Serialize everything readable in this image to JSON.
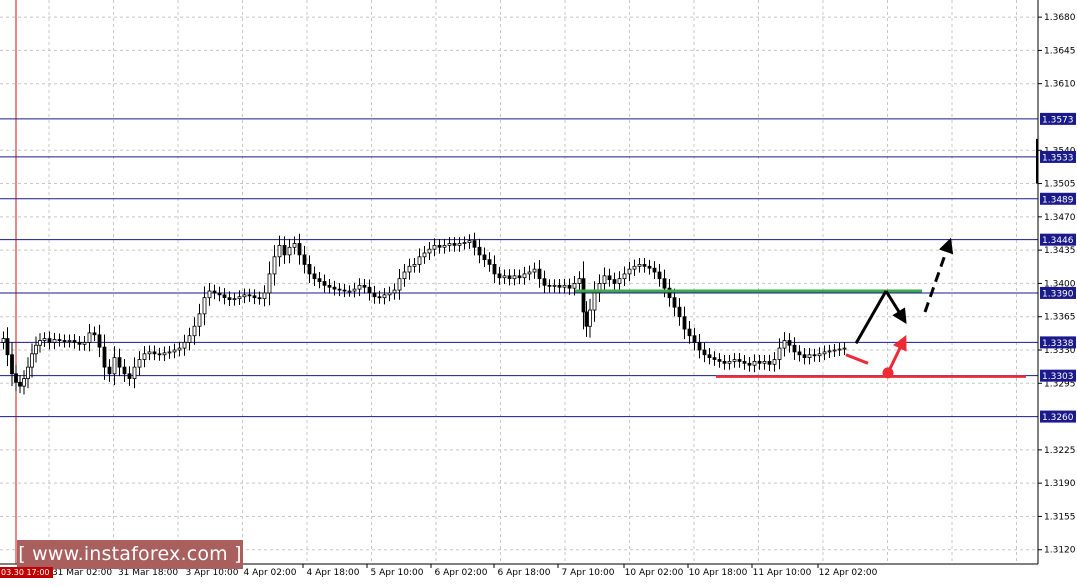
{
  "watermark": "[ www.instaforex.com ]",
  "cursor_label": "03.30 17:00",
  "chart_data": {
    "type": "candlestick",
    "ylim": [
      1.3105,
      1.3698
    ],
    "y_ticks": [
      "1.3680",
      "1.3645",
      "1.3610",
      "1.3540",
      "1.3505",
      "1.3470",
      "1.3435",
      "1.3400",
      "1.3365",
      "1.3330",
      "1.3295",
      "1.3225",
      "1.3190",
      "1.3155",
      "1.3120"
    ],
    "x_tick_labels": [
      "31 Mar 02:00",
      "31 Mar 18:00",
      "3 Apr 10:00",
      "4 Apr 02:00",
      "4 Apr 18:00",
      "5 Apr 10:00",
      "6 Apr 02:00",
      "6 Apr 18:00",
      "7 Apr 10:00",
      "10 Apr 02:00",
      "10 Apr 18:00",
      "11 Apr 10:00",
      "12 Apr 02:00"
    ],
    "levels": [
      {
        "label": "1.3573",
        "value": 1.3573
      },
      {
        "label": "1.3533",
        "value": 1.3533
      },
      {
        "label": "1.3489",
        "value": 1.3489
      },
      {
        "label": "1.3446",
        "value": 1.3446
      },
      {
        "label": "1.3390",
        "value": 1.339
      },
      {
        "label": "1.3338",
        "value": 1.3338
      },
      {
        "label": "1.3303",
        "value": 1.3303
      },
      {
        "label": "1.3260",
        "value": 1.326
      }
    ],
    "support_line": {
      "value": 1.3302,
      "color": "#ee2a35"
    },
    "resistance_line": {
      "value": 1.3392,
      "color": "#3aaa4a"
    },
    "price_path": [
      [
        0,
        1.3338
      ],
      [
        3,
        1.3342
      ],
      [
        8,
        1.3325
      ],
      [
        12,
        1.3305
      ],
      [
        16,
        1.3296
      ],
      [
        20,
        1.3292
      ],
      [
        24,
        1.33
      ],
      [
        28,
        1.3312
      ],
      [
        32,
        1.3326
      ],
      [
        36,
        1.3335
      ],
      [
        40,
        1.334
      ],
      [
        45,
        1.3342
      ],
      [
        50,
        1.3338
      ],
      [
        55,
        1.3341
      ],
      [
        60,
        1.334
      ],
      [
        65,
        1.3339
      ],
      [
        70,
        1.334
      ],
      [
        75,
        1.3338
      ],
      [
        80,
        1.3336
      ],
      [
        85,
        1.3338
      ],
      [
        90,
        1.3348
      ],
      [
        95,
        1.3346
      ],
      [
        100,
        1.3333
      ],
      [
        105,
        1.3312
      ],
      [
        110,
        1.3305
      ],
      [
        115,
        1.3322
      ],
      [
        120,
        1.3312
      ],
      [
        125,
        1.3305
      ],
      [
        130,
        1.33
      ],
      [
        135,
        1.3312
      ],
      [
        140,
        1.332
      ],
      [
        145,
        1.3326
      ],
      [
        150,
        1.3328
      ],
      [
        155,
        1.3326
      ],
      [
        160,
        1.3325
      ],
      [
        165,
        1.3327
      ],
      [
        170,
        1.3328
      ],
      [
        175,
        1.333
      ],
      [
        180,
        1.3332
      ],
      [
        185,
        1.3338
      ],
      [
        190,
        1.3345
      ],
      [
        195,
        1.3355
      ],
      [
        200,
        1.3368
      ],
      [
        205,
        1.3385
      ],
      [
        210,
        1.3392
      ],
      [
        215,
        1.339
      ],
      [
        220,
        1.3388
      ],
      [
        225,
        1.3385
      ],
      [
        230,
        1.3383
      ],
      [
        235,
        1.3384
      ],
      [
        240,
        1.3386
      ],
      [
        245,
        1.3388
      ],
      [
        250,
        1.3387
      ],
      [
        255,
        1.3385
      ],
      [
        260,
        1.3384
      ],
      [
        265,
        1.339
      ],
      [
        270,
        1.341
      ],
      [
        275,
        1.3428
      ],
      [
        280,
        1.344
      ],
      [
        285,
        1.343
      ],
      [
        290,
        1.3438
      ],
      [
        295,
        1.3442
      ],
      [
        300,
        1.343
      ],
      [
        305,
        1.342
      ],
      [
        310,
        1.341
      ],
      [
        315,
        1.3405
      ],
      [
        320,
        1.3402
      ],
      [
        325,
        1.3398
      ],
      [
        330,
        1.3396
      ],
      [
        335,
        1.3394
      ],
      [
        340,
        1.3393
      ],
      [
        345,
        1.3392
      ],
      [
        350,
        1.3392
      ],
      [
        355,
        1.3394
      ],
      [
        360,
        1.3398
      ],
      [
        365,
        1.3396
      ],
      [
        370,
        1.339
      ],
      [
        375,
        1.3386
      ],
      [
        380,
        1.3385
      ],
      [
        385,
        1.3388
      ],
      [
        390,
        1.339
      ],
      [
        395,
        1.3393
      ],
      [
        400,
        1.3405
      ],
      [
        405,
        1.3412
      ],
      [
        410,
        1.3418
      ],
      [
        415,
        1.342
      ],
      [
        420,
        1.3428
      ],
      [
        425,
        1.3432
      ],
      [
        430,
        1.3436
      ],
      [
        435,
        1.344
      ],
      [
        440,
        1.3438
      ],
      [
        445,
        1.344
      ],
      [
        450,
        1.3442
      ],
      [
        455,
        1.344
      ],
      [
        460,
        1.3442
      ],
      [
        465,
        1.3443
      ],
      [
        470,
        1.3445
      ],
      [
        475,
        1.3438
      ],
      [
        480,
        1.343
      ],
      [
        485,
        1.3425
      ],
      [
        490,
        1.342
      ],
      [
        495,
        1.341
      ],
      [
        500,
        1.3406
      ],
      [
        505,
        1.3408
      ],
      [
        510,
        1.3405
      ],
      [
        515,
        1.3408
      ],
      [
        520,
        1.3406
      ],
      [
        525,
        1.341
      ],
      [
        530,
        1.3412
      ],
      [
        535,
        1.3415
      ],
      [
        540,
        1.3405
      ],
      [
        545,
        1.3398
      ],
      [
        550,
        1.3397
      ],
      [
        555,
        1.3398
      ],
      [
        560,
        1.3396
      ],
      [
        565,
        1.3398
      ],
      [
        570,
        1.3395
      ],
      [
        575,
        1.34
      ],
      [
        580,
        1.3405
      ],
      [
        583,
        1.337
      ],
      [
        586,
        1.3355
      ],
      [
        590,
        1.3372
      ],
      [
        595,
        1.339
      ],
      [
        600,
        1.34
      ],
      [
        605,
        1.3408
      ],
      [
        610,
        1.3404
      ],
      [
        615,
        1.34
      ],
      [
        620,
        1.3405
      ],
      [
        625,
        1.341
      ],
      [
        630,
        1.3415
      ],
      [
        635,
        1.3418
      ],
      [
        640,
        1.342
      ],
      [
        645,
        1.3418
      ],
      [
        650,
        1.3416
      ],
      [
        655,
        1.3412
      ],
      [
        660,
        1.3405
      ],
      [
        665,
        1.3395
      ],
      [
        670,
        1.3385
      ],
      [
        675,
        1.3375
      ],
      [
        680,
        1.3365
      ],
      [
        685,
        1.3352
      ],
      [
        690,
        1.3345
      ],
      [
        695,
        1.3338
      ],
      [
        700,
        1.333
      ],
      [
        705,
        1.3325
      ],
      [
        710,
        1.3322
      ],
      [
        715,
        1.332
      ],
      [
        720,
        1.3318
      ],
      [
        725,
        1.3316
      ],
      [
        730,
        1.3318
      ],
      [
        735,
        1.332
      ],
      [
        740,
        1.3318
      ],
      [
        745,
        1.3316
      ],
      [
        750,
        1.3314
      ],
      [
        755,
        1.3318
      ],
      [
        760,
        1.3316
      ],
      [
        765,
        1.3318
      ],
      [
        770,
        1.3315
      ],
      [
        775,
        1.332
      ],
      [
        780,
        1.3332
      ],
      [
        785,
        1.334
      ],
      [
        790,
        1.3335
      ],
      [
        795,
        1.3328
      ],
      [
        800,
        1.3325
      ],
      [
        805,
        1.3322
      ],
      [
        810,
        1.3325
      ],
      [
        815,
        1.3324
      ],
      [
        820,
        1.3326
      ],
      [
        825,
        1.3328
      ],
      [
        830,
        1.3329
      ],
      [
        835,
        1.333
      ],
      [
        840,
        1.3331
      ],
      [
        845,
        1.3332
      ]
    ],
    "forecast_arrows": [
      {
        "style": "solid",
        "color": "#000000",
        "from": [
          856,
          1.3337
        ],
        "to": [
          886,
          1.3392
        ]
      },
      {
        "style": "solid",
        "color": "#000000",
        "from": [
          886,
          1.3392
        ],
        "to": [
          905,
          1.336
        ]
      },
      {
        "style": "dashed",
        "color": "#000000",
        "from": [
          925,
          1.337
        ],
        "to": [
          950,
          1.3445
        ]
      },
      {
        "style": "solid",
        "color": "#ee2a35",
        "from": [
          888,
          1.3306
        ],
        "to": [
          905,
          1.3343
        ]
      },
      {
        "style": "solid",
        "color": "#ee2a35",
        "from": [
          846,
          1.3325
        ],
        "to": [
          868,
          1.3316
        ]
      }
    ]
  }
}
